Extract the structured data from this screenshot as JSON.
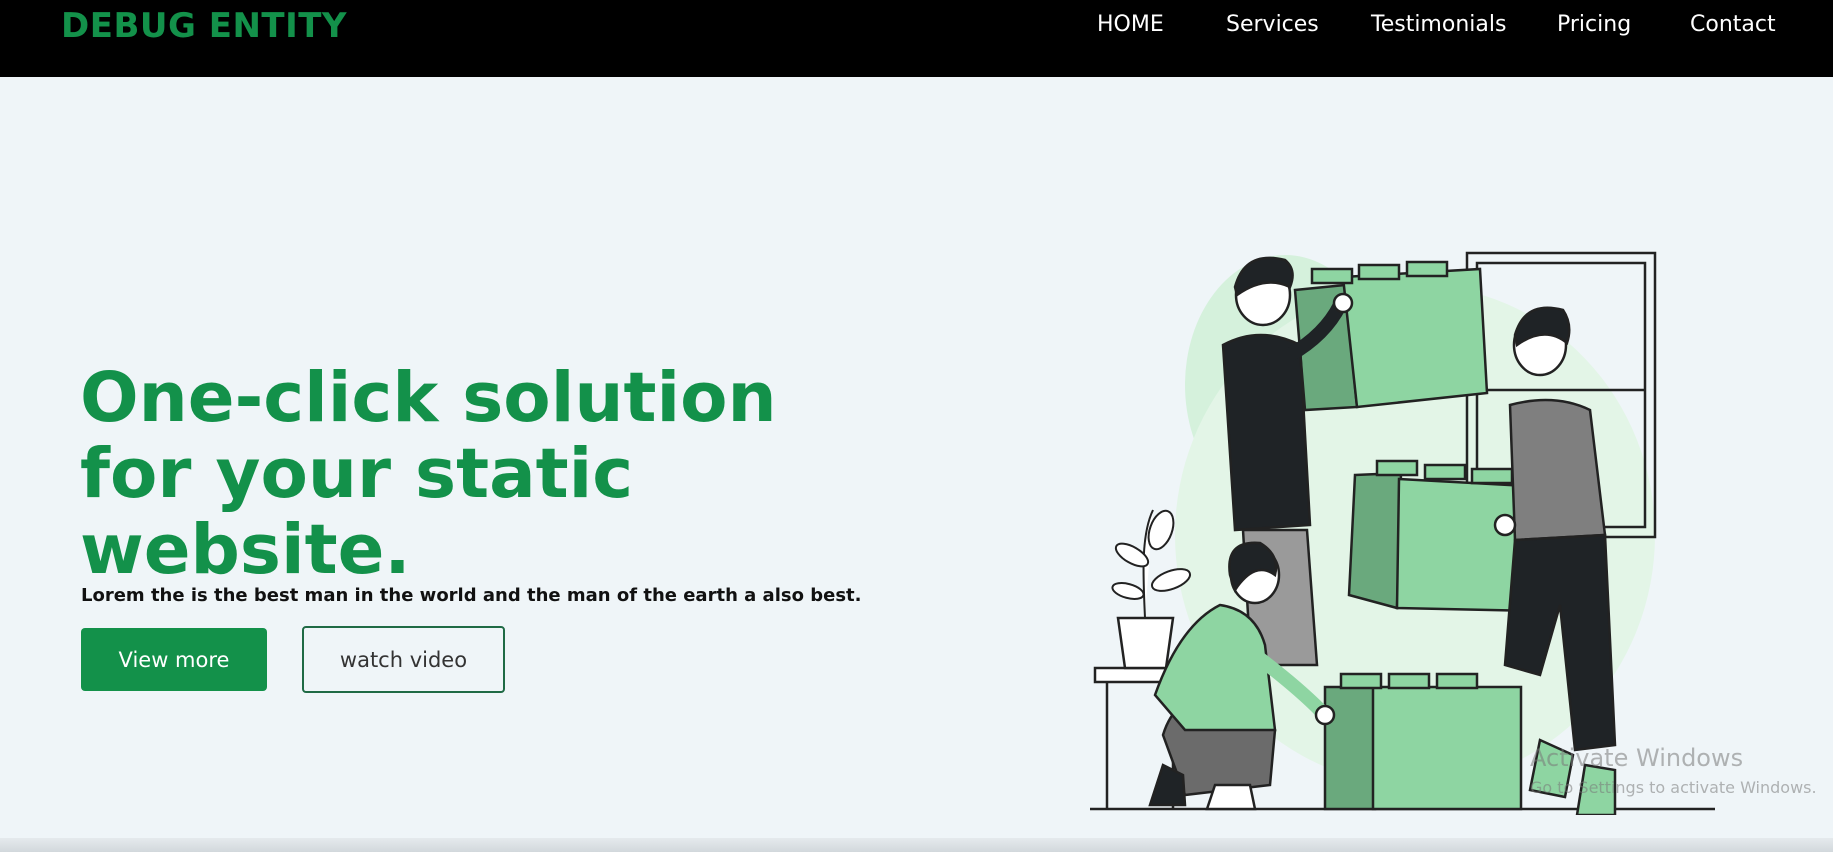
{
  "brand": {
    "name": "DEBUG ENTITY",
    "color": "#13914a"
  },
  "nav": {
    "items": [
      {
        "label": "HOME"
      },
      {
        "label": "Services"
      },
      {
        "label": "Testimonials"
      },
      {
        "label": "Pricing"
      },
      {
        "label": "Contact"
      }
    ]
  },
  "hero": {
    "title_lines": [
      "One-click solution",
      "for your static",
      "website."
    ],
    "subtitle": "Lorem the is the best man in the world and the man of the earth a also best.",
    "primary_button": "View more",
    "secondary_button": "watch video"
  },
  "illustration": {
    "name": "people-stacking-green-blocks-illustration"
  },
  "watermark": {
    "title": "Activate Windows",
    "subtitle": "Go to Settings to activate Windows."
  },
  "colors": {
    "accent": "#13914a",
    "navbar": "#000000",
    "background": "#eff5f8",
    "block_green": "#8ed5a2",
    "block_dark": "#6aa97d"
  }
}
